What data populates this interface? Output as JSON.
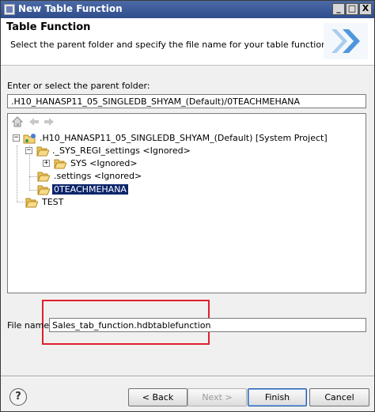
{
  "window": {
    "title": "New Table Function"
  },
  "titlebar_buttons": {
    "minimize": "_",
    "maximize": "□",
    "close": "X"
  },
  "header": {
    "title": "Table Function",
    "description": "Select the parent folder and specify the file name for your table function."
  },
  "parent_folder": {
    "label": "Enter or select the parent folder:",
    "value": ".H10_HANASP11_05_SINGLEDB_SHYAM_(Default)/0TEACHMEHANA"
  },
  "tree": {
    "items": [
      {
        "label": ".H10_HANASP11_05_SINGLEDB_SHYAM_(Default) [System Project]",
        "expander": "−"
      },
      {
        "label": "._SYS_REGI_settings <Ignored>",
        "expander": "−"
      },
      {
        "label": "SYS <Ignored>",
        "expander": "+"
      },
      {
        "label": ".settings <Ignored>"
      },
      {
        "label": "0TEACHMEHANA",
        "selected": true
      },
      {
        "label": "TEST"
      }
    ]
  },
  "file_name": {
    "label": "File name:",
    "value": "Sales_tab_function.hdbtablefunction"
  },
  "buttons": {
    "help": "?",
    "back": "< Back",
    "next": "Next >",
    "finish": "Finish",
    "cancel": "Cancel"
  },
  "colors": {
    "selection": "#0a246a",
    "highlight_box": "#e0202a",
    "titlebar": "#3a5898"
  }
}
